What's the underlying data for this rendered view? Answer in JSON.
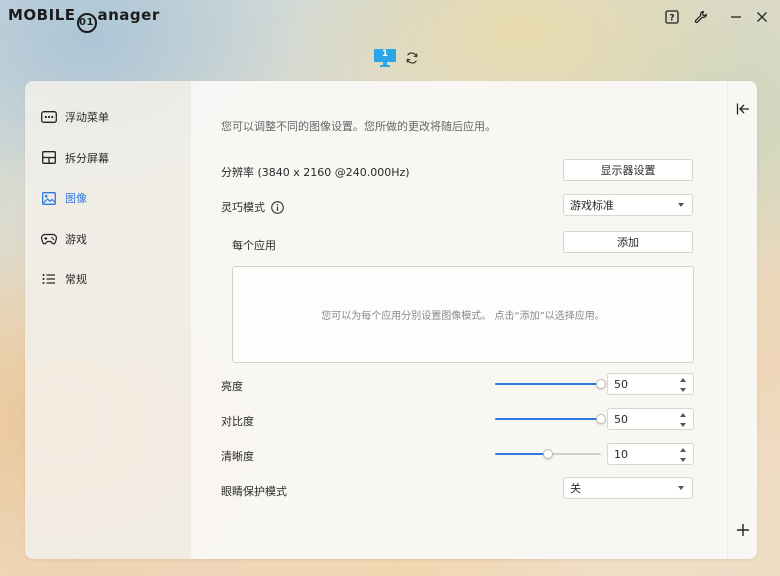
{
  "app": {
    "logo_text": "MOBILE01",
    "logo_suffix": "anager"
  },
  "window_controls": [
    "help-icon",
    "wrench-icon",
    "minimize-icon",
    "close-icon"
  ],
  "monitor_selector": {
    "monitor_number": "1",
    "refresh_icon": "refresh-icon"
  },
  "sidebar": {
    "items": [
      {
        "label": "浮动菜单",
        "icon": "ellipsis-box-icon",
        "active": false
      },
      {
        "label": "拆分屏幕",
        "icon": "split-screen-icon",
        "active": false
      },
      {
        "label": "图像",
        "icon": "image-icon",
        "active": true
      },
      {
        "label": "游戏",
        "icon": "gamepad-icon",
        "active": false
      },
      {
        "label": "常规",
        "icon": "list-icon",
        "active": false
      }
    ]
  },
  "image": {
    "description": "您可以调整不同的图像设置。您所做的更改将随后应用。",
    "resolution_label": "分辨率 (3840 x 2160 @240.000Hz)",
    "display_settings_button": "显示器设置",
    "smart_mode_label": "灵巧模式",
    "smart_mode_value": "游戏标准",
    "per_app_label": "每个应用",
    "add_button": "添加",
    "per_app_placeholder": "您可以为每个应用分别设置图像模式。 点击“添加”以选择应用。",
    "brightness": {
      "label": "亮度",
      "value": "50",
      "slider_fraction": 1.0
    },
    "contrast": {
      "label": "对比度",
      "value": "50",
      "slider_fraction": 1.0
    },
    "sharpness": {
      "label": "清晰度",
      "value": "10",
      "slider_fraction": 0.5
    },
    "eye_care_label": "眼睛保护模式",
    "eye_care_value": "关"
  },
  "rightbar": {
    "collapse_icon": "collapse-left-icon",
    "add_icon": "plus-icon"
  },
  "colors": {
    "accent": "#2c7be5",
    "monitor_icon": "#2aa5e6"
  }
}
